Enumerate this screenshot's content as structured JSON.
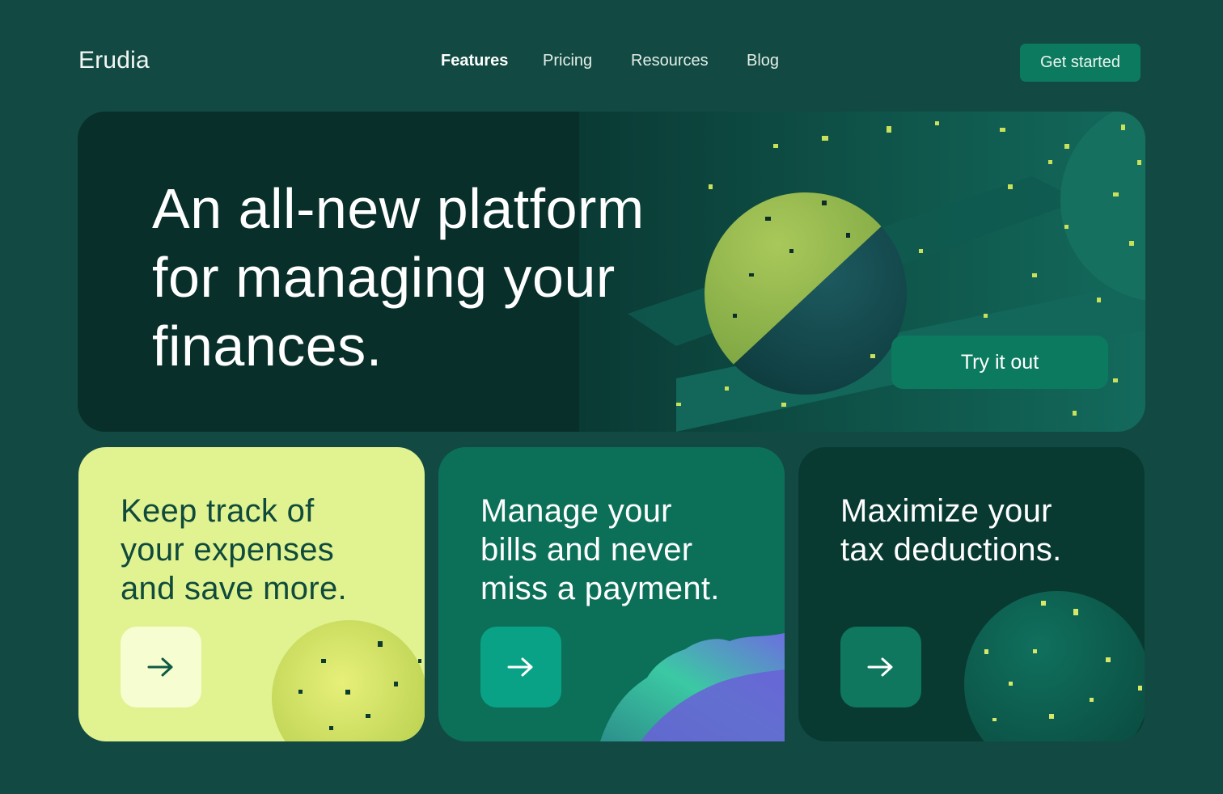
{
  "brand": {
    "logo": "Erudia"
  },
  "nav": {
    "items": [
      {
        "label": "Features",
        "active": true
      },
      {
        "label": "Pricing",
        "active": false
      },
      {
        "label": "Resources",
        "active": false
      },
      {
        "label": "Blog",
        "active": false
      }
    ],
    "cta_label": "Get started"
  },
  "hero": {
    "title_lines": [
      "An all-new platform",
      "for managing your",
      "finances."
    ],
    "cta_label": "Try it out"
  },
  "cards": [
    {
      "title_lines": [
        "Keep track of",
        "your expenses",
        "and save more."
      ],
      "icon": "arrow-right-icon"
    },
    {
      "title_lines": [
        "Manage your",
        "bills and never",
        "miss a payment."
      ],
      "icon": "arrow-right-icon"
    },
    {
      "title_lines": [
        "Maximize your",
        "tax deductions."
      ],
      "icon": "arrow-right-icon"
    }
  ],
  "colors": {
    "background": "#124a43",
    "hero_bg": "#082f29",
    "accent": "#0c7a5f",
    "card_lime": "#e1f291",
    "card_green": "#0c7059",
    "card_dark": "#083a32"
  }
}
